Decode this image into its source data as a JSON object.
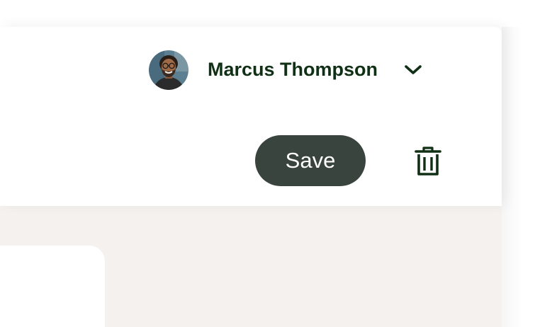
{
  "header": {
    "user_name": "Marcus Thompson",
    "avatar_icon": "user-avatar-photo",
    "menu_icon": "chevron-down-icon"
  },
  "toolbar": {
    "save_label": "Save",
    "delete_icon": "trash-icon"
  },
  "colors": {
    "text_dark_green": "#103015",
    "button_bg": "#3a443f",
    "page_bg": "#f4f1ee"
  }
}
